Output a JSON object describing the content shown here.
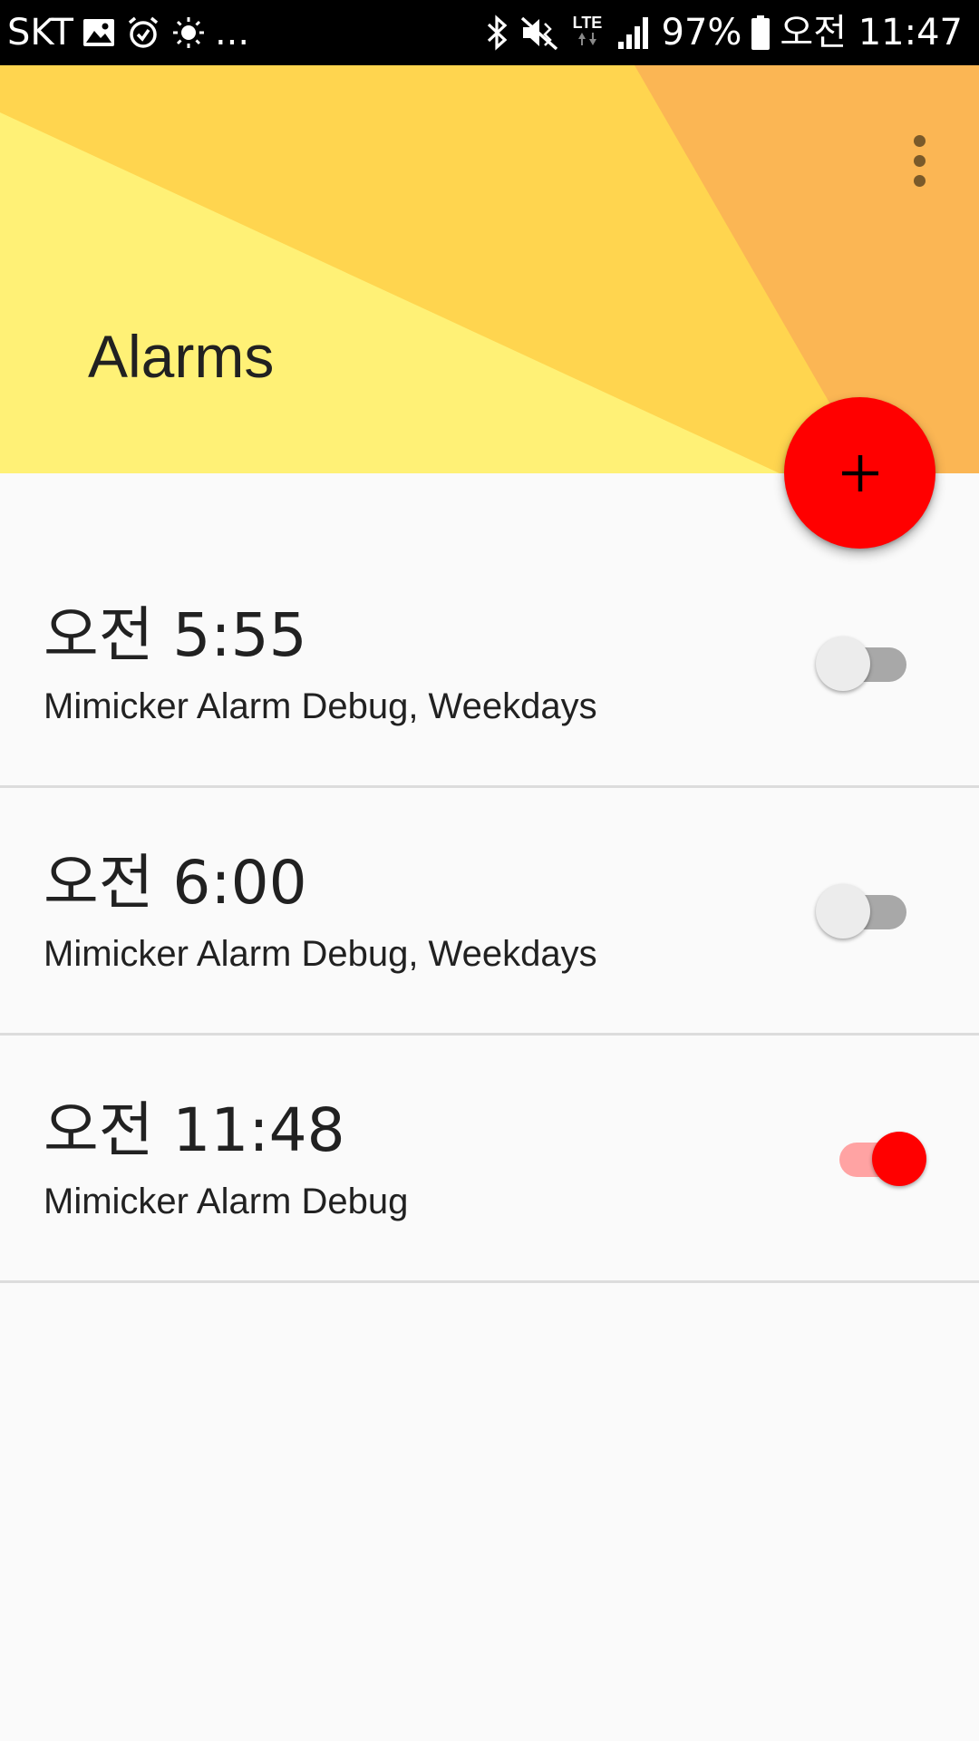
{
  "status_bar": {
    "carrier": "SKT",
    "icons_left": [
      "image-icon",
      "alarm-icon",
      "brightness-icon"
    ],
    "overflow": "...",
    "icons_right": [
      "bluetooth-icon",
      "mute-icon",
      "lte-icon",
      "signal-icon"
    ],
    "lte_label": "LTE",
    "battery": "97%",
    "time": "오전 11:47"
  },
  "header": {
    "title": "Alarms",
    "colors": {
      "light_yellow": "#fff176",
      "yellow": "#ffd54f",
      "orange": "#fbb654"
    },
    "more_icon": "more-vert-icon"
  },
  "fab": {
    "icon": "add-icon",
    "color": "#ff0000"
  },
  "alarms": [
    {
      "time": "오전 5:55",
      "label": "Mimicker Alarm Debug, Weekdays",
      "enabled": false
    },
    {
      "time": "오전 6:00",
      "label": "Mimicker Alarm Debug, Weekdays",
      "enabled": false
    },
    {
      "time": "오전 11:48",
      "label": "Mimicker Alarm Debug",
      "enabled": true
    }
  ],
  "accent_color": "#ff0000"
}
